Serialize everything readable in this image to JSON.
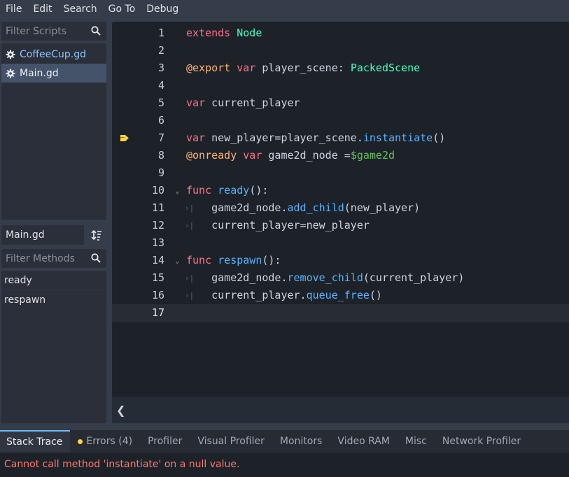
{
  "menu": [
    "File",
    "Edit",
    "Search",
    "Go To",
    "Debug"
  ],
  "scripts_filter": {
    "placeholder": "Filter Scripts",
    "icon": "search-icon"
  },
  "scripts": [
    {
      "name": "CoffeeCup.gd",
      "icon": "gear-icon",
      "selected": false
    },
    {
      "name": "Main.gd",
      "icon": "gear-icon",
      "selected": true
    }
  ],
  "current_file": "Main.gd",
  "methods_filter": {
    "placeholder": "Filter Methods",
    "icon": "search-icon"
  },
  "methods": [
    "ready",
    "respawn"
  ],
  "code": {
    "current_line": 17,
    "execution_line": 7,
    "lines": [
      {
        "n": "1",
        "text": "extends Node"
      },
      {
        "n": "2",
        "text": ""
      },
      {
        "n": "3",
        "text": "@export var player_scene: PackedScene"
      },
      {
        "n": "4",
        "text": ""
      },
      {
        "n": "5",
        "text": "var current_player"
      },
      {
        "n": "6",
        "text": ""
      },
      {
        "n": "7",
        "text": "var new_player=player_scene.instantiate()"
      },
      {
        "n": "8",
        "text": "@onready var game2d_node =$game2d"
      },
      {
        "n": "9",
        "text": ""
      },
      {
        "n": "10",
        "text": "func ready():"
      },
      {
        "n": "11",
        "text": "    game2d_node.add_child(new_player)"
      },
      {
        "n": "12",
        "text": "    current_player=new_player"
      },
      {
        "n": "13",
        "text": ""
      },
      {
        "n": "14",
        "text": "func respawn():"
      },
      {
        "n": "15",
        "text": "    game2d_node.remove_child(current_player)"
      },
      {
        "n": "16",
        "text": "    current_player.queue_free()"
      },
      {
        "n": "17",
        "text": ""
      }
    ]
  },
  "bottom_tabs": [
    {
      "label": "Stack Trace",
      "active": true
    },
    {
      "label": "Errors (4)",
      "active": false,
      "indicator": "warning-dot"
    },
    {
      "label": "Profiler",
      "active": false
    },
    {
      "label": "Visual Profiler",
      "active": false
    },
    {
      "label": "Monitors",
      "active": false
    },
    {
      "label": "Video RAM",
      "active": false
    },
    {
      "label": "Misc",
      "active": false
    },
    {
      "label": "Network Profiler",
      "active": false
    }
  ],
  "error_message": "Cannot call method 'instantiate' on a null value.",
  "colors": {
    "keyword": "#ff7085",
    "type": "#42ffc2",
    "function": "#57b3ff",
    "annotation": "#ffb373",
    "node_path": "#63c259",
    "error": "#ff786b",
    "accent": "#70bafa"
  }
}
